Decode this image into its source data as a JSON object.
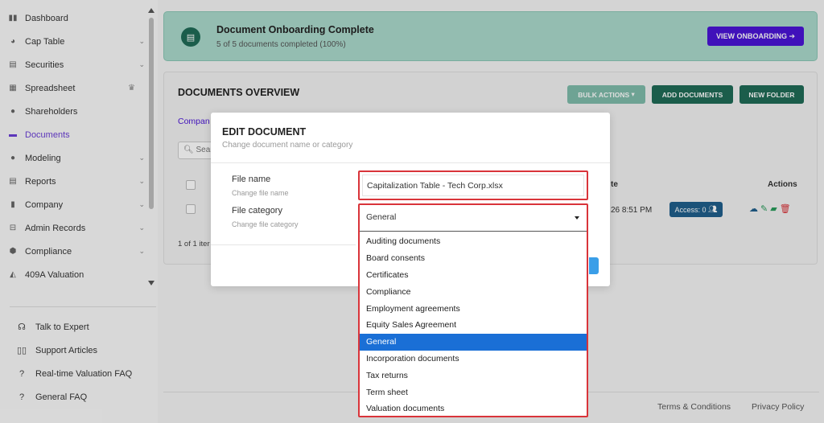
{
  "sidebar": {
    "items": [
      {
        "label": "Dashboard",
        "icon": "dashboard-icon",
        "glyph": "▮▮",
        "chevron": false
      },
      {
        "label": "Cap Table",
        "icon": "pie-chart-icon",
        "glyph": "◕",
        "chevron": true
      },
      {
        "label": "Securities",
        "icon": "clipboard-icon",
        "glyph": "▤",
        "chevron": true
      },
      {
        "label": "Spreadsheet",
        "icon": "table-icon",
        "glyph": "▦",
        "chevron": false,
        "badge": "♛"
      },
      {
        "label": "Shareholders",
        "icon": "user-icon",
        "glyph": "●",
        "chevron": false
      },
      {
        "label": "Documents",
        "icon": "folder-icon",
        "glyph": "▬",
        "chevron": false,
        "active": true
      },
      {
        "label": "Modeling",
        "icon": "lightbulb-icon",
        "glyph": "●",
        "chevron": true
      },
      {
        "label": "Reports",
        "icon": "report-icon",
        "glyph": "▤",
        "chevron": true
      },
      {
        "label": "Company",
        "icon": "building-icon",
        "glyph": "▮",
        "chevron": true
      },
      {
        "label": "Admin Records",
        "icon": "records-icon",
        "glyph": "⊟",
        "chevron": true
      },
      {
        "label": "Compliance",
        "icon": "shield-icon",
        "glyph": "⬢",
        "chevron": true
      },
      {
        "label": "409A Valuation",
        "icon": "valuation-icon",
        "glyph": "◭",
        "chevron": false
      }
    ],
    "help": [
      {
        "label": "Talk to Expert",
        "icon": "headset-icon",
        "glyph": "☊"
      },
      {
        "label": "Support Articles",
        "icon": "book-icon",
        "glyph": "▯▯"
      },
      {
        "label": "Real-time Valuation FAQ",
        "icon": "question-icon",
        "glyph": "?"
      },
      {
        "label": "General FAQ",
        "icon": "question-icon",
        "glyph": "?"
      }
    ]
  },
  "banner": {
    "title": "Document Onboarding Complete",
    "subtitle": "5 of 5 documents completed (100%)",
    "button": "VIEW ONBOARDING ➔"
  },
  "documents": {
    "title": "DOCUMENTS OVERVIEW",
    "bulk_actions": "BULK ACTIONS",
    "add_documents": "ADD DOCUMENTS",
    "new_folder": "NEW FOLDER",
    "company_link": "Compan",
    "search_placeholder": "Sear",
    "col_date": "te",
    "col_actions": "Actions",
    "row_date": "26 8:51 PM",
    "access": "Access: 0",
    "items_count": "1 of 1 iter"
  },
  "footer": {
    "terms": "Terms & Conditions",
    "privacy": "Privacy Policy"
  },
  "modal": {
    "title": "EDIT DOCUMENT",
    "subtitle": "Change document name or category",
    "file_name_label": "File name",
    "file_name_hint": "Change file name",
    "file_name_value": "Capitalization Table - Tech Corp.xlsx",
    "category_label": "File category",
    "category_hint": "Change file category",
    "category_value": "General",
    "options": [
      "Auditing documents",
      "Board consents",
      "Certificates",
      "Compliance",
      "Employment agreements",
      "Equity Sales Agreement",
      "General",
      "Incorporation documents",
      "Tax returns",
      "Term sheet",
      "Valuation documents"
    ],
    "selected_option": "General"
  },
  "colors": {
    "accent": "#4a14d6",
    "teal": "#1f6b57",
    "highlight": "#d9343a",
    "selected": "#1a6fd6"
  }
}
